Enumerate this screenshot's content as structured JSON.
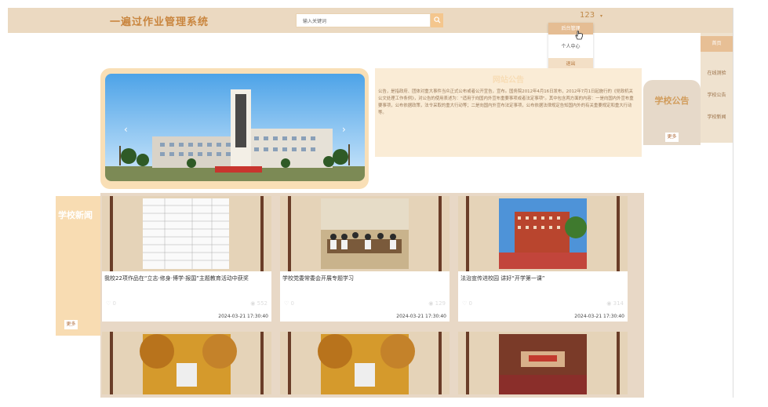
{
  "header": {
    "title": "一遍过作业管理系统",
    "search_placeholder": "输入关键词",
    "username": "123",
    "caret": "▾"
  },
  "dropdown": {
    "items": [
      "后台管理",
      "个人中心",
      "退出"
    ]
  },
  "right_nav": {
    "items": [
      "首页",
      "在线测验",
      "学校公告",
      "学校新闻"
    ]
  },
  "notice": {
    "title": "网站公告",
    "body": "公告，是指政府、团体对重大事件当众正式公布或者公开宣告，宣布。国务院2012年4月16日发布，2012年7月1日起施行的《党政机关公文处理工作条例》，对公告的使用表述为：\"适用于向国内外宣布重要事项或者法定事项\"。其中包含两方面的内容：一是向国内外宣布重要事项，公布依据政策，法令采取的重大行动等；二是向国内外宣布法定事项，公布依据法律规定告知国内外的有关重要规定和重大行动等。"
  },
  "school_notice": {
    "title": "学校公告",
    "more": "更多"
  },
  "school_news": {
    "title": "学校新闻",
    "more": "更多"
  },
  "news_cards": [
    {
      "title": "我校22项作品在“立志·修身·博学·报国”主题教育活动中获奖",
      "likes": "0",
      "views": "552",
      "date": "2024-03-21 17:30:40"
    },
    {
      "title": "学校党委常委会开展专题学习",
      "likes": "0",
      "views": "129",
      "date": "2024-03-21 17:30:40"
    },
    {
      "title": "法治宣传进校园 讲好“开学第一课”",
      "likes": "0",
      "views": "314",
      "date": "2024-03-21 17:30:40"
    }
  ],
  "colors": {
    "accent": "#e7bf95",
    "header_bg": "#ebd9c1",
    "title": "#c9853e"
  }
}
